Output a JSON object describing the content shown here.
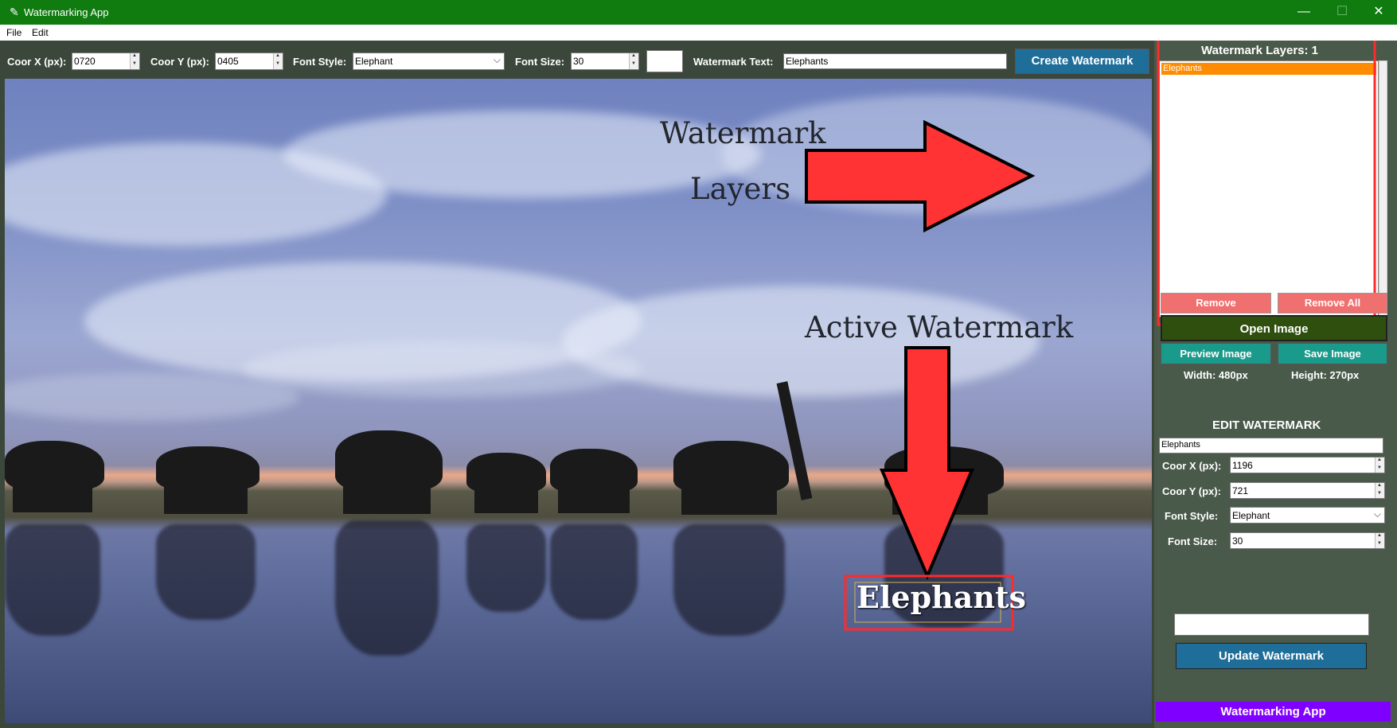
{
  "window": {
    "title": "Watermarking App",
    "minimize": "—",
    "maximize": "☐",
    "close": "✕"
  },
  "menu": {
    "file": "File",
    "edit": "Edit"
  },
  "toolbar": {
    "coor_x_label": "Coor X (px):",
    "coor_x_value": "0720",
    "coor_y_label": "Coor Y (px):",
    "coor_y_value": "0405",
    "font_style_label": "Font Style:",
    "font_style_value": "Elephant",
    "font_size_label": "Font Size:",
    "font_size_value": "30",
    "watermark_text_label": "Watermark Text:",
    "watermark_text_value": "Elephants",
    "create_button": "Create Watermark"
  },
  "canvas": {
    "annotation_1": "Watermark",
    "annotation_2": "Layers",
    "annotation_3": "Active Watermark",
    "watermark": "Elephants"
  },
  "panel": {
    "layers_title": "Watermark Layers: 1",
    "layers": [
      "Elephants"
    ],
    "remove": "Remove",
    "remove_all": "Remove All",
    "open_image": "Open Image",
    "preview_image": "Preview Image",
    "save_image": "Save Image",
    "width": "Width: 480px",
    "height": "Height: 270px",
    "edit_title": "EDIT WATERMARK",
    "edit_text": "Elephants",
    "edit_coor_x_label": "Coor X (px):",
    "edit_coor_x_value": "1196",
    "edit_coor_y_label": "Coor Y (px):",
    "edit_coor_y_value": "721",
    "edit_font_style_label": "Font Style:",
    "edit_font_style_value": "Elephant",
    "edit_font_size_label": "Font Size:",
    "edit_font_size_value": "30",
    "update_button": "Update Watermark",
    "footer": "Watermarking App"
  },
  "colors": {
    "titlebar": "#107c10",
    "accent_blue": "#1f6e9a",
    "teal": "#1a9a8a",
    "remove_red": "#f07070",
    "open_green": "#2f4f0f",
    "footer_purple": "#8000ff",
    "layer_selected": "#ff8c00",
    "annotation_red": "#ff2a2a"
  }
}
